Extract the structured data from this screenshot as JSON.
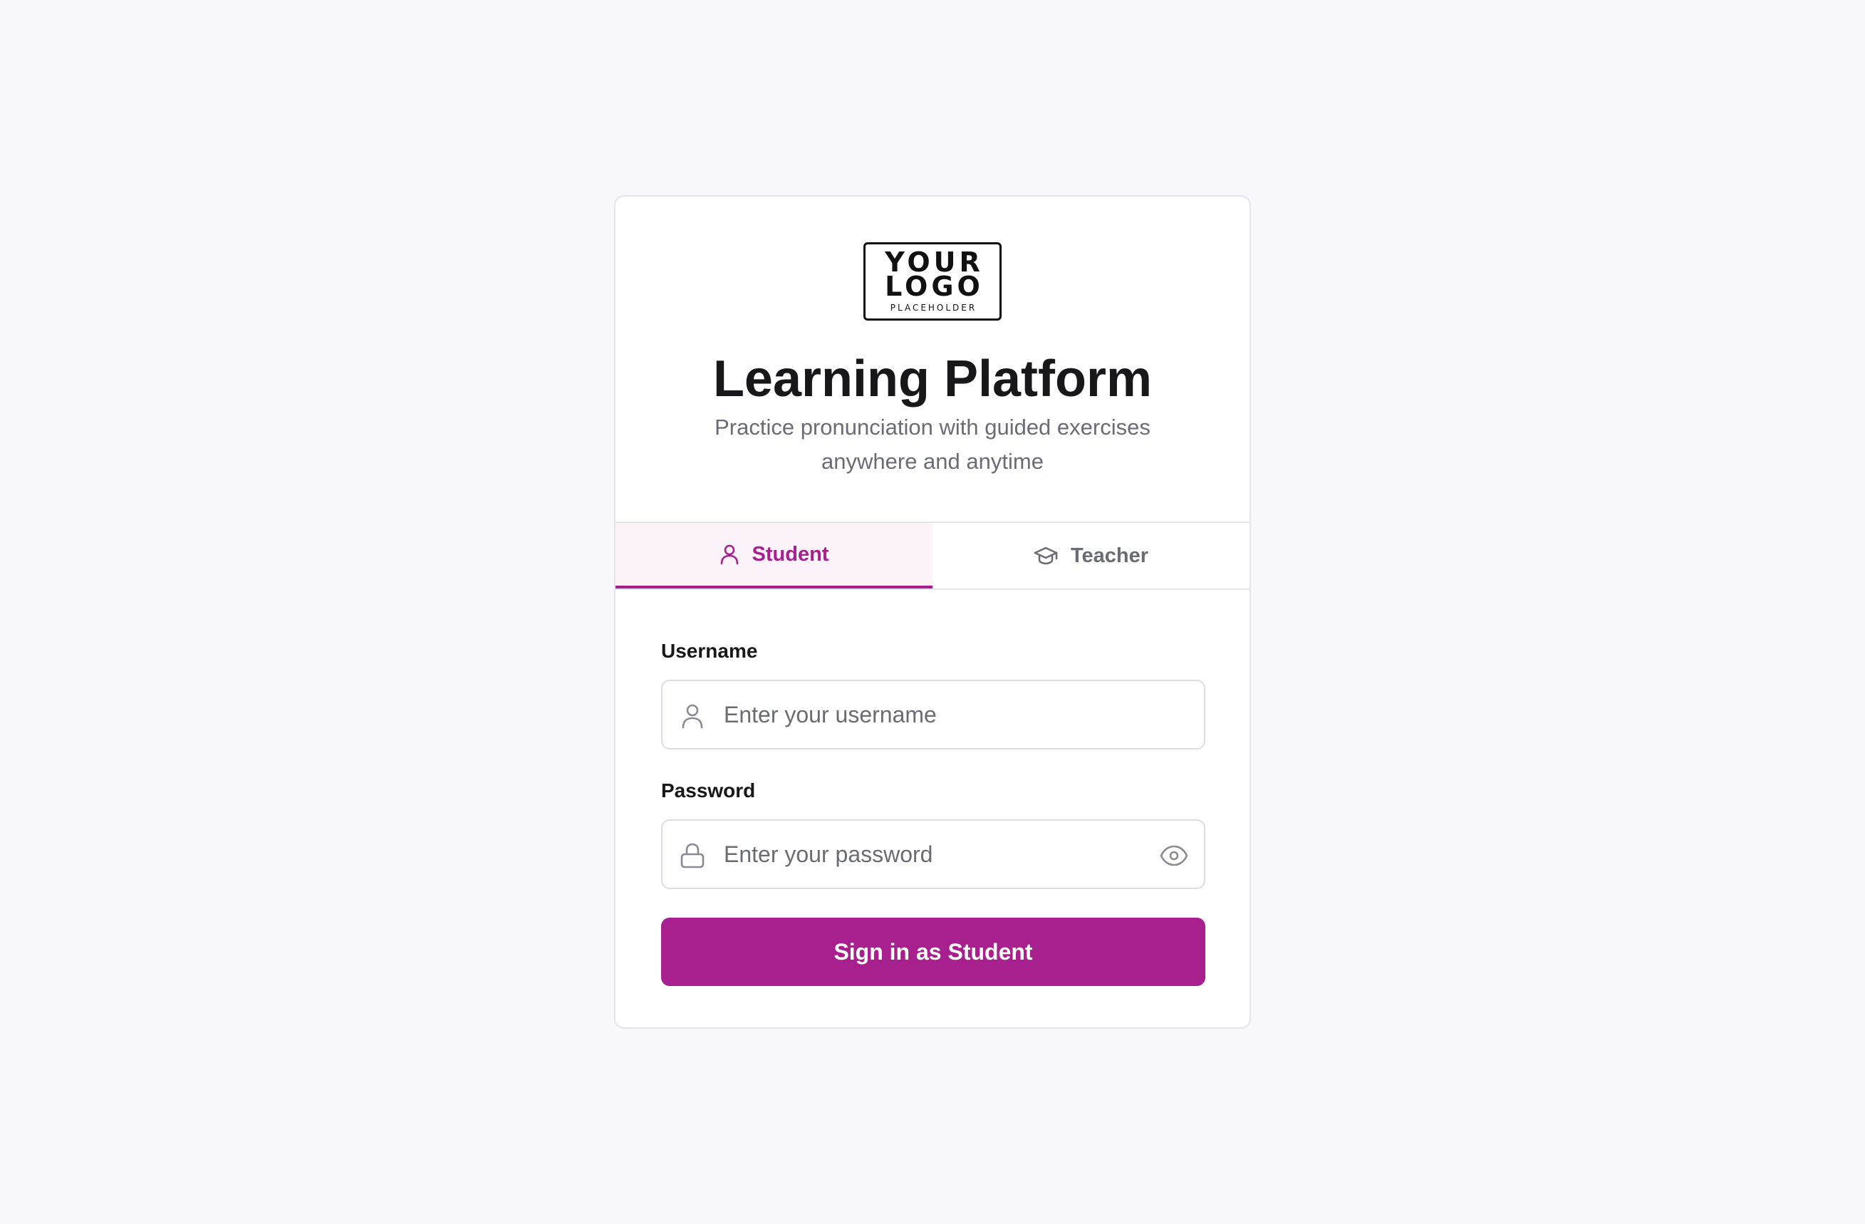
{
  "brand": {
    "logo_line1": "YOUR",
    "logo_line2": "LOGO",
    "logo_line3": "PLACEHOLDER",
    "title": "Learning Platform",
    "subtitle": "Practice pronunciation with guided exercises anywhere and anytime"
  },
  "tabs": [
    {
      "label": "Student",
      "icon": "user-icon",
      "active": true
    },
    {
      "label": "Teacher",
      "icon": "graduation-cap-icon",
      "active": false
    }
  ],
  "form": {
    "username_label": "Username",
    "username_placeholder": "Enter your username",
    "username_value": "",
    "password_label": "Password",
    "password_placeholder": "Enter your password",
    "password_value": "",
    "submit_label": "Sign in as Student"
  },
  "colors": {
    "accent": "#a8208d",
    "active_tab_bg": "#fbf3f9",
    "page_bg": "#f8f7fc",
    "muted_text": "#6b6b76",
    "heading_text": "#18181b"
  }
}
